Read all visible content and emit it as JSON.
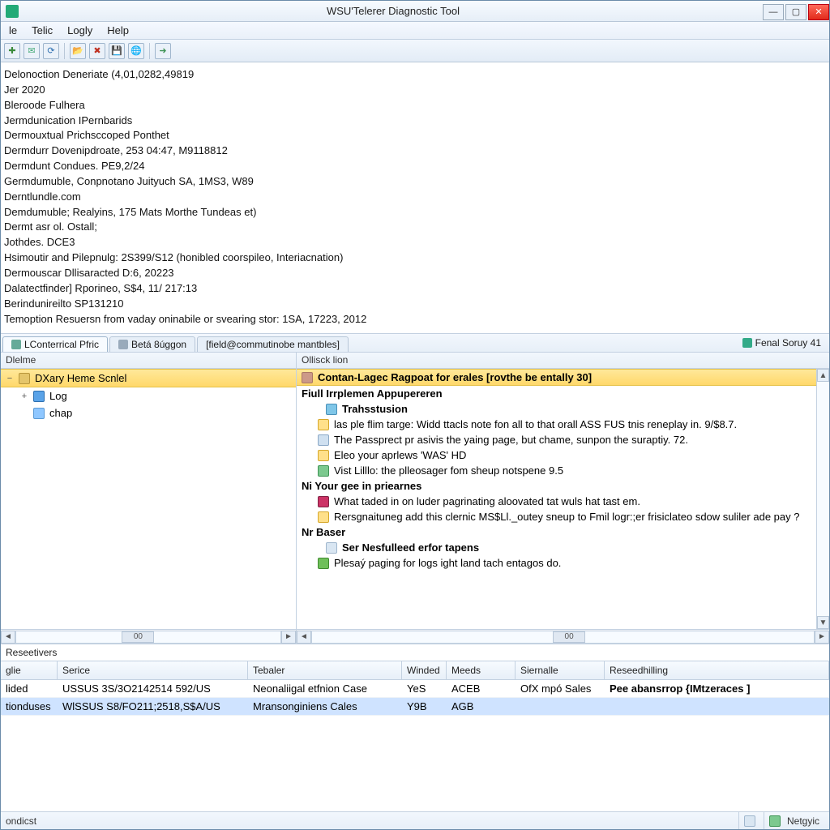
{
  "window": {
    "title": "WSU'Telerer Diagnostic Tool"
  },
  "menu": {
    "items": [
      "le",
      "Telic",
      "Logly",
      "Help"
    ]
  },
  "toolbar": {
    "buttons": [
      {
        "name": "new-icon",
        "glyph": "✚",
        "color": "#3a8a3a"
      },
      {
        "name": "mail-icon",
        "glyph": "✉",
        "color": "#4a7"
      },
      {
        "name": "refresh-icon",
        "glyph": "⟳",
        "color": "#2d6fb0"
      },
      {
        "name": "sep"
      },
      {
        "name": "open-icon",
        "glyph": "📂",
        "color": "#c98"
      },
      {
        "name": "delete-icon",
        "glyph": "✖",
        "color": "#c03020"
      },
      {
        "name": "save-icon",
        "glyph": "💾",
        "color": "#2d4faf"
      },
      {
        "name": "globe-icon",
        "glyph": "🌐",
        "color": "#3a8"
      },
      {
        "name": "sep"
      },
      {
        "name": "forward-icon",
        "glyph": "➜",
        "color": "#3f9455"
      }
    ]
  },
  "upper_lines": [
    "Delonoction Deneriate (4,01,0282,49819",
    "Jer 2020",
    "Bleroode Fulhera",
    "Jermdunication IPernbarids",
    "Dermouxtual Prichsccoped Ponthet",
    "Dermdurr Dovenipdroate,  253 04:47, M9118812",
    "Dermdunt Condues. PE9,2/24",
    "Germdumuble, Conpnotano Juityuch SA, 1MS3, W89",
    "Derntlundle.com",
    "Demdumuble; Realyins, 175 Mats Morthe Tundeas et)",
    "Dermt asr ol. Ostall;",
    "Jothdes. DCE3",
    "Hsimoutir and Pilepnulg: 2S399/S12 (honibled coorspileo, Interiacnation)",
    "Dermouscar Dllisaracted D:6, 20223",
    "Dalatectfinder] Rporineo, S$4, 11/ 217:13",
    "Berindunireilto SP131210",
    "Temoption Resuersn from vaday oninabile or svearing stor: 1SA, 17223, 2012"
  ],
  "tabs": {
    "items": [
      {
        "label": "LConterrical Pfric",
        "active": true
      },
      {
        "label": "Betá 8úggon",
        "active": false
      },
      {
        "label": "[field@commutinobe mantbles]",
        "active": false
      }
    ],
    "right": {
      "label": "Fenal Soruy 41"
    }
  },
  "left_pane": {
    "header": "Dlelme",
    "tree": [
      {
        "label": "DXary Heme Scnlel",
        "icon": "folder",
        "selected": true,
        "exp": "−"
      },
      {
        "label": "Log",
        "icon": "log",
        "exp": "+",
        "indent": 1
      },
      {
        "label": "chap",
        "icon": "chap",
        "exp": "",
        "indent": 1
      }
    ],
    "scroll_label": "00"
  },
  "right_pane": {
    "header": "Ollisck lion",
    "title": "Contan-Lagec Ragpoat for erales [rovthe be entally 30]",
    "sections": [
      {
        "type": "section",
        "text": "Fiull Irrplemen Appupereren"
      },
      {
        "type": "sub",
        "icon": "flask",
        "text": "Trahsstusion"
      },
      {
        "type": "item",
        "icon": "warn",
        "text": "las ple flim targe: Widd ttacls note fon all to that orall ASS FUS tnis reneplay in. 9/$8.7."
      },
      {
        "type": "item",
        "icon": "info",
        "text": "The Passprect pr asivis the yaing page, but chame, sunpon the suraptiy. 72."
      },
      {
        "type": "item",
        "icon": "warn",
        "text": "Eleo your aprlews 'WAS' HD"
      },
      {
        "type": "item",
        "icon": "globe",
        "text": "Vist Lilllo: the plleosager fom sheup notspene 9.5"
      },
      {
        "type": "section",
        "text": "Ni Your gee in priearnes"
      },
      {
        "type": "item",
        "icon": "red",
        "text": "What taded in on luder pagrinating aloovated tat wuls hat tast em."
      },
      {
        "type": "item",
        "icon": "warn",
        "text": "Rersgnaituneg add this clernic MS$Ll._outey sneup to Fmil logr:;er frisiclateo sdow suliler ade pay ?"
      },
      {
        "type": "section",
        "text": "Nr Baser"
      },
      {
        "type": "sub",
        "icon": "page",
        "text": "Ser Nesfulleed erfor tapens"
      },
      {
        "type": "item",
        "icon": "green",
        "text": "Plesaý paging for logs ight land tach entagos do."
      }
    ],
    "scroll_label": "00"
  },
  "grid": {
    "title": "Reseetivers",
    "columns": [
      "glie",
      "Serice",
      "Tebaler",
      "Winded",
      "Meeds",
      "Siernalle",
      "Reseedhilling"
    ],
    "rows": [
      {
        "selected": false,
        "cells": [
          "lided",
          "USSUS 3S/3O2142514 592/US",
          "Neonaliigal etfnion Case",
          "YeS",
          "ACEB",
          "OfX mpó Sales",
          "Pee abansrrop {IMtzeraces ]"
        ],
        "bold_last": true
      },
      {
        "selected": true,
        "cells": [
          "tionduses",
          "WlSSUS S8/FO211;2518,S$A/US",
          "Mransonginiens Cales",
          "Y9B",
          "AGB",
          "",
          ""
        ],
        "bold_last": false
      }
    ]
  },
  "status": {
    "left": "ondicst",
    "right": "Netgyic"
  }
}
